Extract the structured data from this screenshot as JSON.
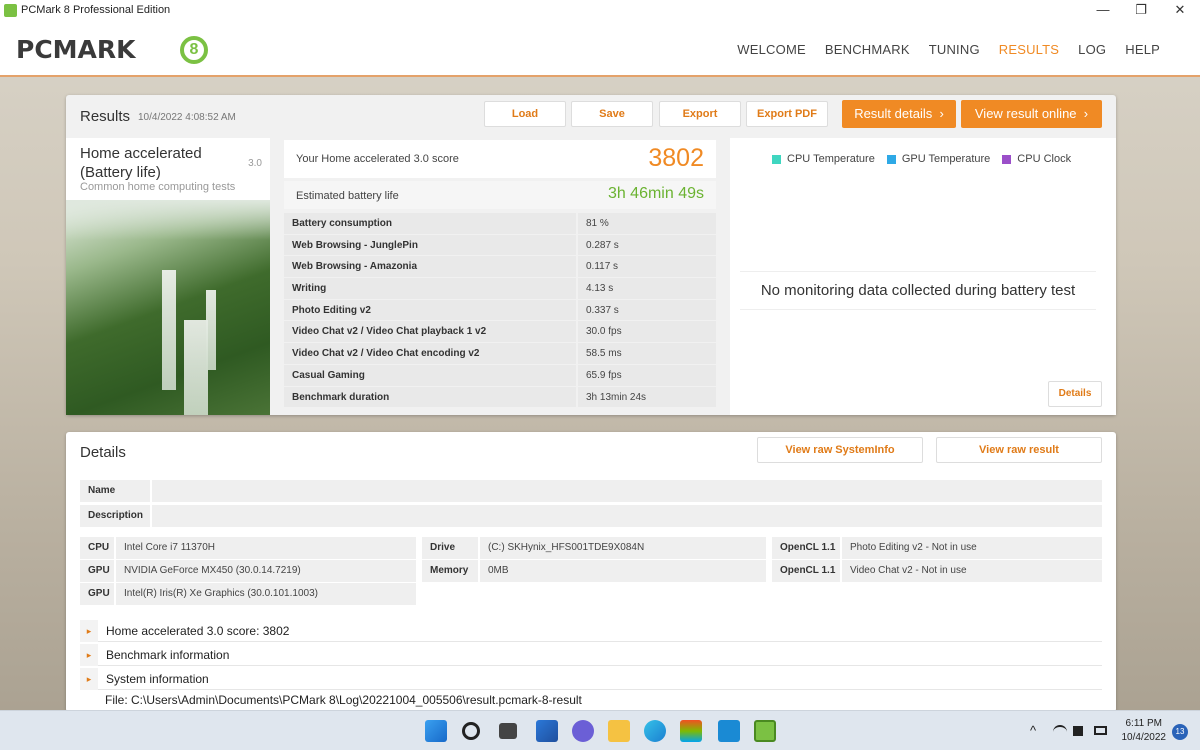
{
  "window": {
    "title": "PCMark 8 Professional Edition",
    "minimize_glyph": "—",
    "maximize_glyph": "❐",
    "close_glyph": "✕"
  },
  "header": {
    "logo_text": "PCMARK",
    "logo_number": "8",
    "nav": [
      {
        "label": "WELCOME"
      },
      {
        "label": "BENCHMARK"
      },
      {
        "label": "TUNING"
      },
      {
        "label": "RESULTS",
        "active": true
      },
      {
        "label": "LOG"
      },
      {
        "label": "HELP"
      }
    ],
    "accent_color": "#f08a24",
    "brand_green": "#7bc143"
  },
  "results": {
    "title": "Results",
    "timestamp": "10/4/2022 4:08:52 AM",
    "buttons": {
      "load": "Load",
      "save": "Save",
      "export": "Export",
      "export_pdf": "Export PDF",
      "result_details": "Result details",
      "view_online": "View result online"
    },
    "test": {
      "name": "Home accelerated (Battery life)",
      "version": "3.0",
      "subtitle": "Common home computing tests"
    },
    "score_label": "Your Home accelerated 3.0 score",
    "score": "3802",
    "battery_label": "Estimated battery life",
    "battery_value": "3h 46min 49s",
    "subscores": [
      {
        "name": "Battery consumption",
        "value": "81 %"
      },
      {
        "name": "Web Browsing - JunglePin",
        "value": "0.287 s"
      },
      {
        "name": "Web Browsing - Amazonia",
        "value": "0.117 s"
      },
      {
        "name": "Writing",
        "value": "4.13 s"
      },
      {
        "name": "Photo Editing v2",
        "value": "0.337 s"
      },
      {
        "name": "Video Chat v2 / Video Chat playback 1 v2",
        "value": "30.0 fps"
      },
      {
        "name": "Video Chat v2 / Video Chat encoding v2",
        "value": "58.5 ms"
      },
      {
        "name": "Casual Gaming",
        "value": "65.9 fps"
      },
      {
        "name": "Benchmark duration",
        "value": "3h 13min 24s"
      }
    ],
    "monitoring": {
      "legend": [
        {
          "label": "CPU Temperature",
          "color": "#3fd6c0"
        },
        {
          "label": "GPU Temperature",
          "color": "#2ea9e6"
        },
        {
          "label": "CPU Clock",
          "color": "#9b4fc9"
        }
      ],
      "message": "No monitoring data collected during battery test",
      "details_button": "Details"
    }
  },
  "details": {
    "title": "Details",
    "view_raw_sysinfo": "View raw SystemInfo",
    "view_raw_result": "View raw result",
    "name_label": "Name",
    "name_value": "",
    "description_label": "Description",
    "description_value": "",
    "cpu_label": "CPU",
    "cpu_value": "Intel Core i7 11370H",
    "gpu1_label": "GPU",
    "gpu1_value": "NVIDIA GeForce MX450 (30.0.14.7219)",
    "gpu2_label": "GPU",
    "gpu2_value": "Intel(R) Iris(R) Xe Graphics (30.0.101.1003)",
    "drive_label": "Drive",
    "drive_value": "(C:) SKHynix_HFS001TDE9X084N",
    "memory_label": "Memory",
    "memory_value": "0MB",
    "opencl1_label": "OpenCL 1.1",
    "opencl1_value": "Photo Editing v2 - Not in use",
    "opencl2_label": "OpenCL 1.1",
    "opencl2_value": "Video Chat v2 - Not in use",
    "expanders": [
      {
        "label": "Home accelerated 3.0 score: 3802"
      },
      {
        "label": "Benchmark information"
      },
      {
        "label": "System information"
      }
    ],
    "expander_glyph": "▸",
    "file_path": "File: C:\\Users\\Admin\\Documents\\PCMark 8\\Log\\20221004_005506\\result.pcmark-8-result"
  },
  "taskbar": {
    "clock_time": "6:11 PM",
    "clock_date": "10/4/2022",
    "notification_count": "13",
    "tray_chevron": "^",
    "icons": [
      "windows-start-icon",
      "search-icon",
      "task-view-icon",
      "widgets-icon",
      "teams-chat-icon",
      "file-explorer-icon",
      "edge-browser-icon",
      "store-icon",
      "app-l-icon",
      "pcmark-icon"
    ]
  }
}
